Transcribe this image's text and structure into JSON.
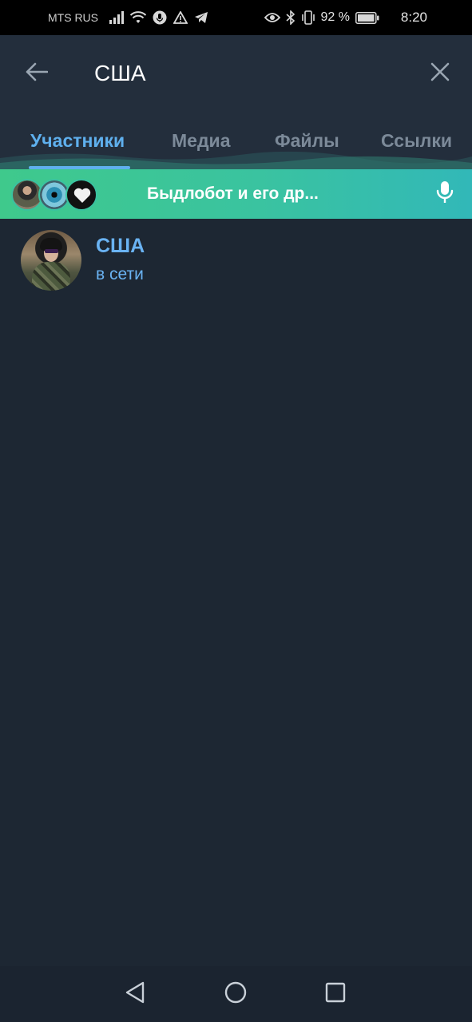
{
  "status_bar": {
    "carrier": "MTS RUS",
    "battery_percent": "92 %",
    "time": "8:20",
    "icons": [
      "signal-icon",
      "wifi-icon",
      "mic-status-icon",
      "warning-icon",
      "telegram-icon",
      "eye-icon",
      "bluetooth-icon",
      "vibrate-icon",
      "battery-icon"
    ]
  },
  "header": {
    "search_query": "США",
    "back_icon": "arrow-left-icon",
    "close_icon": "close-icon"
  },
  "tabs": [
    {
      "label": "Участники",
      "active": true
    },
    {
      "label": "Медиа",
      "active": false
    },
    {
      "label": "Файлы",
      "active": false
    },
    {
      "label": "Ссылки",
      "active": false
    }
  ],
  "voice_chat": {
    "title": "Быдлобот и его др...",
    "mic_icon": "microphone-icon"
  },
  "results": [
    {
      "name": "США",
      "status": "в сети"
    }
  ],
  "nav_bar": {
    "icons": [
      "back-triangle-icon",
      "home-circle-icon",
      "recents-square-icon"
    ]
  },
  "colors": {
    "background": "#1d2733",
    "header": "#232e3c",
    "accent": "#5fb0ee",
    "voice_gradient_start": "#3fc98c",
    "voice_gradient_end": "#32b8b8"
  }
}
